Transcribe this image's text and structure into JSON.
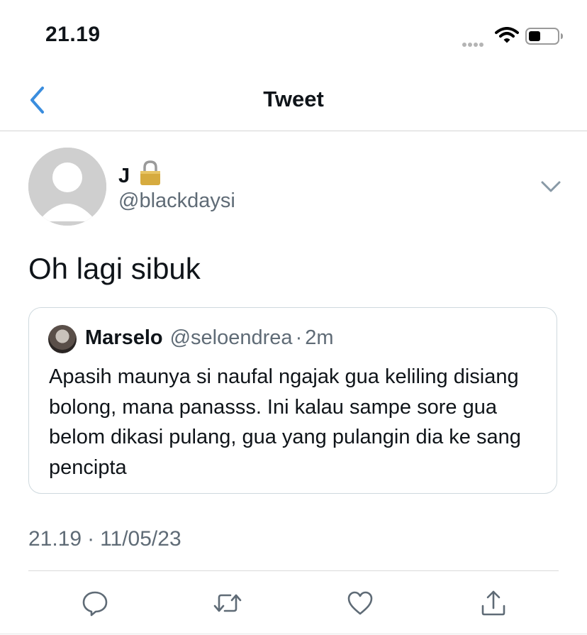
{
  "status_bar": {
    "time": "21.19"
  },
  "nav": {
    "title": "Tweet",
    "back_icon": "chevron-left-icon"
  },
  "tweet": {
    "author": {
      "name": "J",
      "handle": "@blackdaysi",
      "locked": true
    },
    "text": "Oh lagi sibuk",
    "timestamp": {
      "time": "21.19",
      "separator": "·",
      "date": "11/05/23"
    }
  },
  "quoted_tweet": {
    "name": "Marselo",
    "handle": "@seloendrea",
    "separator": "·",
    "time": "2m",
    "text": "Apasih maunya si naufal ngajak gua keliling disiang bolong, mana panasss. Ini kalau sampe sore gua belom dikasi pulang, gua yang pulangin dia ke sang pencipta"
  },
  "actions": [
    "reply-icon",
    "retweet-icon",
    "like-icon",
    "share-icon"
  ],
  "colors": {
    "accent": "#1d9bf0",
    "text": "#0f1419",
    "secondary": "#5f6b76",
    "border": "#cfd9de"
  }
}
